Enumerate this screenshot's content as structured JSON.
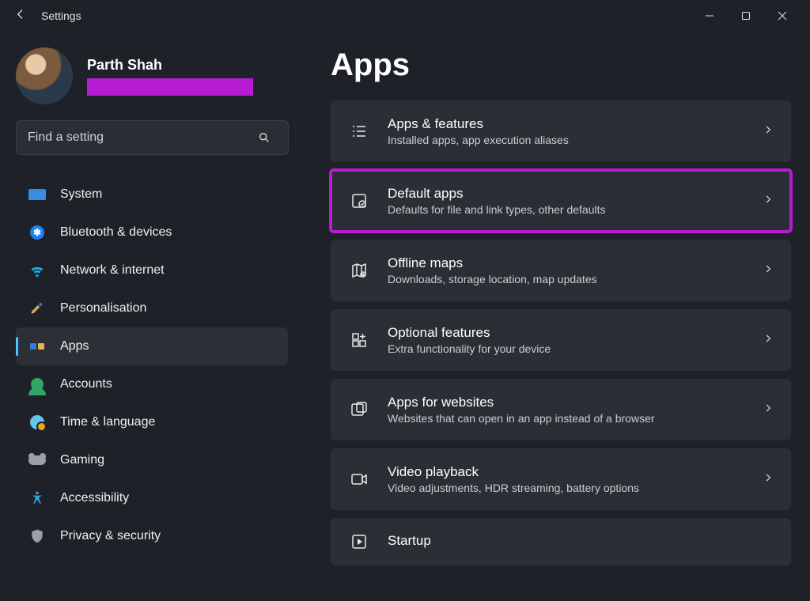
{
  "window": {
    "title": "Settings"
  },
  "accent_highlight": "#b61cd1",
  "profile": {
    "name": "Parth Shah"
  },
  "search": {
    "placeholder": "Find a setting"
  },
  "nav": {
    "items": [
      {
        "label": "System"
      },
      {
        "label": "Bluetooth & devices"
      },
      {
        "label": "Network & internet"
      },
      {
        "label": "Personalisation"
      },
      {
        "label": "Apps"
      },
      {
        "label": "Accounts"
      },
      {
        "label": "Time & language"
      },
      {
        "label": "Gaming"
      },
      {
        "label": "Accessibility"
      },
      {
        "label": "Privacy & security"
      }
    ],
    "selected_index": 4
  },
  "page": {
    "heading": "Apps",
    "cards": [
      {
        "title": "Apps & features",
        "desc": "Installed apps, app execution aliases"
      },
      {
        "title": "Default apps",
        "desc": "Defaults for file and link types, other defaults",
        "highlighted": true
      },
      {
        "title": "Offline maps",
        "desc": "Downloads, storage location, map updates"
      },
      {
        "title": "Optional features",
        "desc": "Extra functionality for your device"
      },
      {
        "title": "Apps for websites",
        "desc": "Websites that can open in an app instead of a browser"
      },
      {
        "title": "Video playback",
        "desc": "Video adjustments, HDR streaming, battery options"
      },
      {
        "title": "Startup",
        "desc": ""
      }
    ]
  }
}
